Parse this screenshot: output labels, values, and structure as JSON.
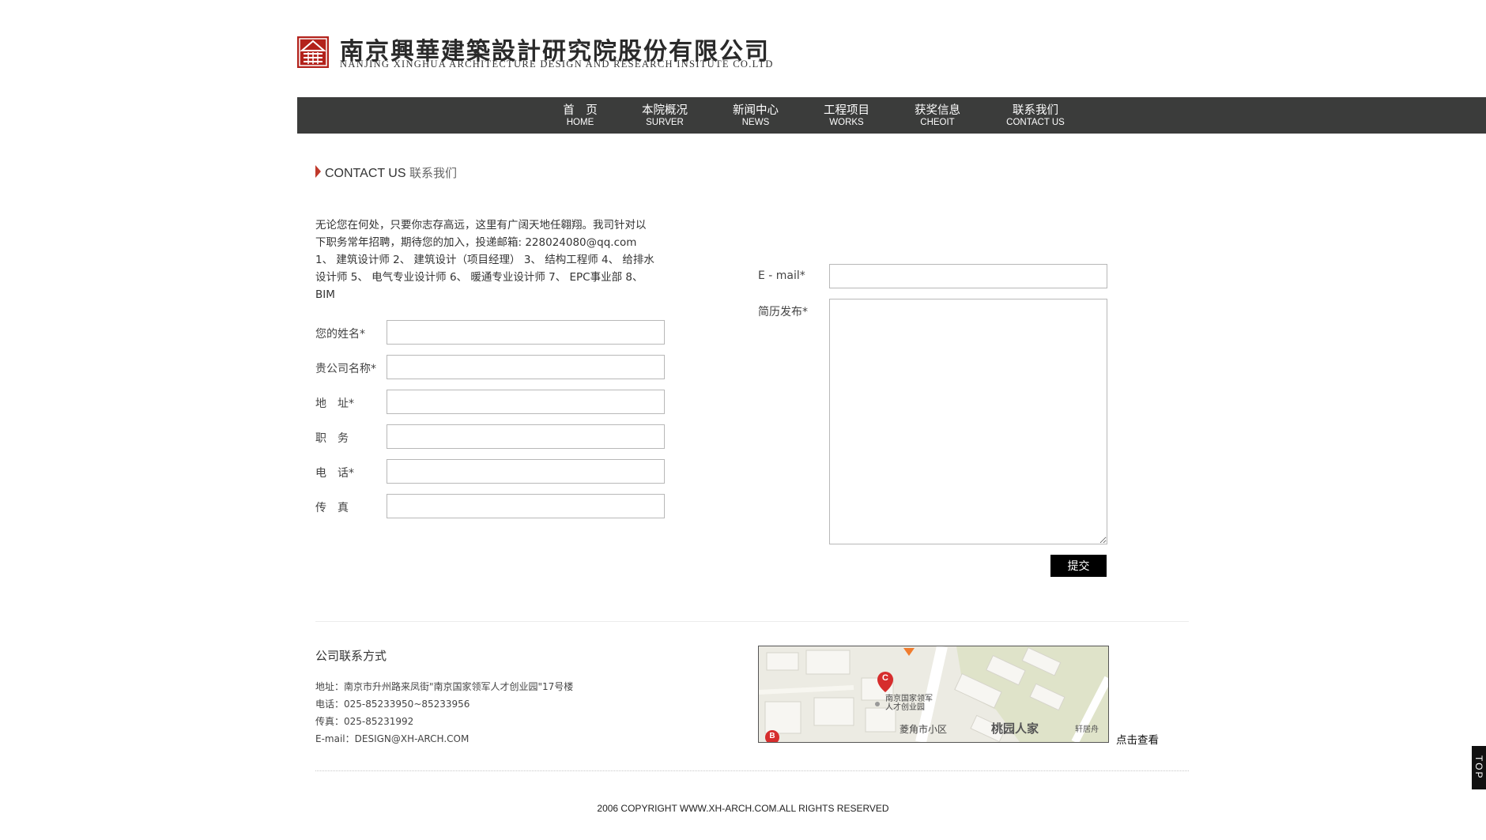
{
  "header": {
    "company_name_cn": "南京興華建築設計研究院股份有限公司",
    "company_name_en": "NANJING XINGHUA ARCHITECTURE DESIGN AND RESEARCH INSITUTE CO.LTD"
  },
  "nav": {
    "items": [
      {
        "cn": "首　页",
        "en": "HOME"
      },
      {
        "cn": "本院概况",
        "en": "SURVER"
      },
      {
        "cn": "新闻中心",
        "en": "NEWS"
      },
      {
        "cn": "工程项目",
        "en": "WORKS"
      },
      {
        "cn": "获奖信息",
        "en": "CHEOIT"
      },
      {
        "cn": "联系我们",
        "en": "CONTACT US"
      }
    ]
  },
  "section": {
    "title_en": "CONTACT US",
    "title_cn": "联系我们"
  },
  "intro": {
    "lines": [
      "无论您在何处，只要你志存高远，这里有广阔天地任翱翔。我司针对以",
      "下职务常年招聘，期待您的加入，投递邮箱: 228024080@qq.com",
      "1、 建筑设计师 2、 建筑设计（项目经理） 3、 结构工程师 4、 给排水",
      "设计师 5、 电气专业设计师 6、 暖通专业设计师 7、 EPC事业部 8、",
      "BIM"
    ]
  },
  "form": {
    "name_label": "您的姓名*",
    "company_label": "贵公司名称*",
    "address_label": "地　址*",
    "position_label": "职　务",
    "phone_label": "电　话*",
    "fax_label": "传　真",
    "email_label": "E - mail*",
    "resume_label": "简历发布*",
    "name_value": "",
    "company_value": "",
    "address_value": "",
    "position_value": "",
    "phone_value": "",
    "fax_value": "",
    "email_value": "",
    "resume_value": "",
    "submit_label": "提交"
  },
  "contact": {
    "heading": "公司联系方式",
    "address": "地址：南京市升州路来凤街\"南京国家领军人才创业园\"17号楼",
    "phone": "电话：025-85233950~85233956",
    "fax": "传真：025-85231992",
    "email": "E-mail：DESIGN@XH-ARCH.COM"
  },
  "map": {
    "marker_c": "C",
    "marker_b": "B",
    "label_park_line1": "南京国家领军",
    "label_park_line2": "人才创业园",
    "label_community": "菱角市小区",
    "label_taoyuan": "桃园人家",
    "label_xuanju": "轩居舟",
    "view_link": "点击查看"
  },
  "footer": {
    "copyright": "2006 COPYRIGHT WWW.XH-ARCH.COM.ALL RIGHTS RESERVED",
    "top_label": "TOP"
  },
  "colors": {
    "nav_bg": "#3b3c3b",
    "accent_red": "#c0392b",
    "button_bg": "#000000"
  }
}
